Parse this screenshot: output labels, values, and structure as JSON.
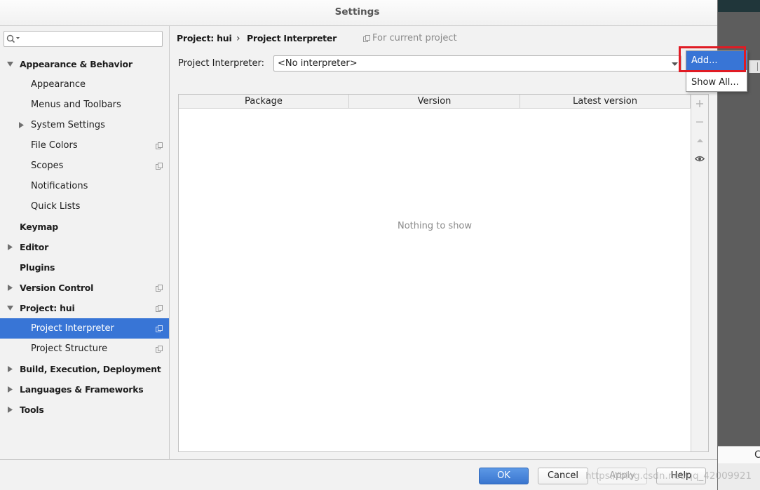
{
  "window": {
    "title": "Settings"
  },
  "search": {
    "value": ""
  },
  "sidebar": {
    "items": [
      {
        "label": "Appearance & Behavior",
        "expanded": true
      },
      {
        "label": "Appearance"
      },
      {
        "label": "Menus and Toolbars"
      },
      {
        "label": "System Settings",
        "expanded": false
      },
      {
        "label": "File Colors",
        "icon": "copy-icon"
      },
      {
        "label": "Scopes",
        "icon": "copy-icon"
      },
      {
        "label": "Notifications"
      },
      {
        "label": "Quick Lists"
      },
      {
        "label": "Keymap"
      },
      {
        "label": "Editor",
        "expanded": false
      },
      {
        "label": "Plugins"
      },
      {
        "label": "Version Control",
        "expanded": false,
        "icon": "copy-icon"
      },
      {
        "label": "Project: hui",
        "expanded": true,
        "icon": "copy-icon"
      },
      {
        "label": "Project Interpreter",
        "selected": true,
        "icon": "copy-icon"
      },
      {
        "label": "Project Structure",
        "icon": "copy-icon"
      },
      {
        "label": "Build, Execution, Deployment",
        "expanded": false
      },
      {
        "label": "Languages & Frameworks",
        "expanded": false
      },
      {
        "label": "Tools",
        "expanded": false
      }
    ]
  },
  "breadcrumb": {
    "parent": "Project: hui",
    "separator": "›",
    "current": "Project Interpreter",
    "scope_icon": "copy-icon",
    "scope_note": "For current project"
  },
  "interpreter": {
    "label": "Project Interpreter:",
    "value": "<No interpreter>"
  },
  "popup_menu": {
    "items": [
      {
        "label": "Add...",
        "highlighted": true
      },
      {
        "label": "Show All..."
      }
    ]
  },
  "table": {
    "columns": [
      "Package",
      "Version",
      "Latest version"
    ],
    "rows": [],
    "empty_text": "Nothing to show",
    "toolbar": [
      "plus-icon",
      "minus-icon",
      "move-up-icon",
      "eye-icon"
    ]
  },
  "buttons": {
    "ok": "OK",
    "cancel": "Cancel",
    "apply": "Apply",
    "apply_enabled": false,
    "help": "Help"
  },
  "background": {
    "partial_text": "C"
  },
  "watermark": {
    "text": "https://blog.csdn.net/qq_42009921"
  },
  "colors": {
    "selection": "#3875d6",
    "highlight_box": "#e01b24",
    "panel": "#f2f2f2"
  }
}
